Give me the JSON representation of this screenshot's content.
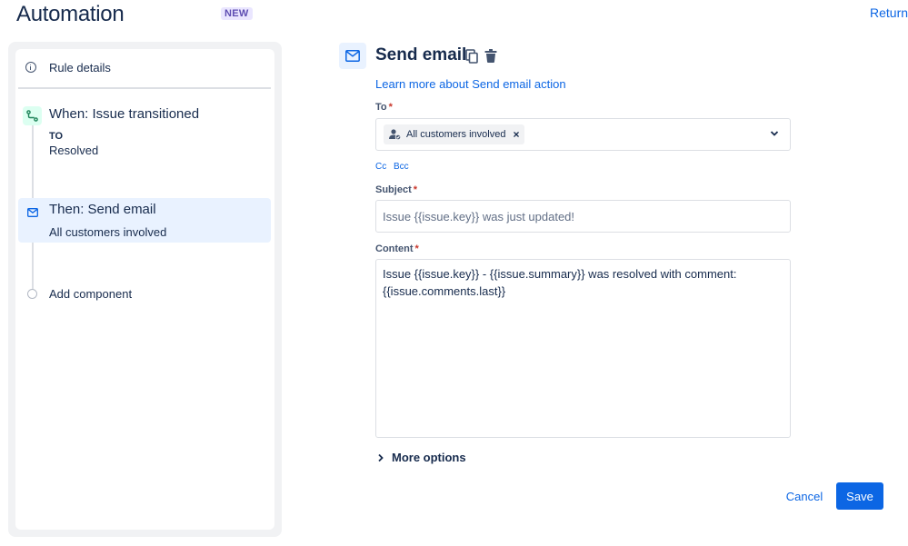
{
  "header": {
    "title": "Automation",
    "badge": "NEW",
    "return_label": "Return"
  },
  "sidebar": {
    "rule_details_label": "Rule details",
    "trigger": {
      "title": "When: Issue transitioned",
      "to_label": "TO",
      "status": "Resolved",
      "icon": "transition-icon"
    },
    "action": {
      "title": "Then: Send email",
      "subtitle": "All customers involved",
      "icon": "mail-icon"
    },
    "add_component_label": "Add component"
  },
  "main": {
    "title": "Send email",
    "learn_more": "Learn more about Send email action",
    "to": {
      "label": "To",
      "chip": "All customers involved",
      "chip_remove": "×"
    },
    "cc_label": "Cc",
    "bcc_label": "Bcc",
    "subject": {
      "label": "Subject",
      "placeholder": "Issue {{issue.key}} was just updated!"
    },
    "content": {
      "label": "Content",
      "value": "Issue {{issue.key}} - {{issue.summary}} was resolved with comment:\n{{issue.comments.last}}"
    },
    "required_mark": "*",
    "more_options_label": "More options"
  },
  "footer": {
    "cancel_label": "Cancel",
    "save_label": "Save"
  },
  "colors": {
    "primary": "#0c66e4",
    "text": "#172b4d",
    "required": "#c9372c",
    "selected_bg": "#e9f2ff",
    "trigger_bg": "#dcfff1"
  }
}
